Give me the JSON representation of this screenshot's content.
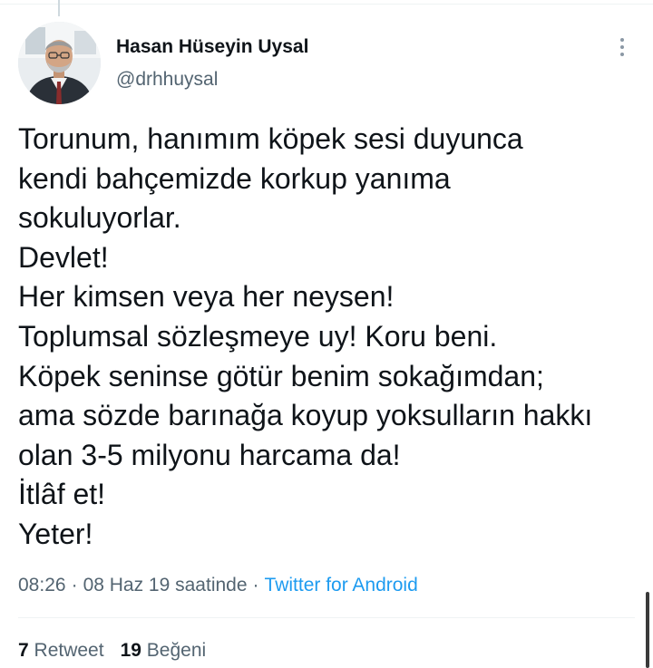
{
  "author": {
    "name": "Hasan Hüseyin Uysal",
    "handle": "@drhhuysal"
  },
  "tweet": {
    "lines": [
      "Torunum, hanımım köpek sesi duyunca",
      "kendi bahçemizde korkup yanıma",
      "sokuluyorlar.",
      "Devlet!",
      "Her kimsen veya her neysen!",
      "Toplumsal sözleşmeye uy! Koru beni.",
      "Köpek seninse götür benim sokağımdan;",
      "ama sözde barınağa koyup yoksulların hakkı",
      "olan 3-5 milyonu harcama da!",
      "İtlâf et!",
      "Yeter!"
    ]
  },
  "meta": {
    "time": "08:26",
    "separator": "·",
    "date": "08 Haz 19 saatinde",
    "source": "Twitter for Android"
  },
  "stats": {
    "retweet_count": "7",
    "retweet_label": "Retweet",
    "like_count": "19",
    "like_label": "Beğeni"
  },
  "icons": {
    "more": "more-vertical-icon"
  },
  "colors": {
    "text": "#0f1419",
    "secondary": "#536471",
    "link": "#1d9bf0",
    "divider": "#eff3f4"
  }
}
